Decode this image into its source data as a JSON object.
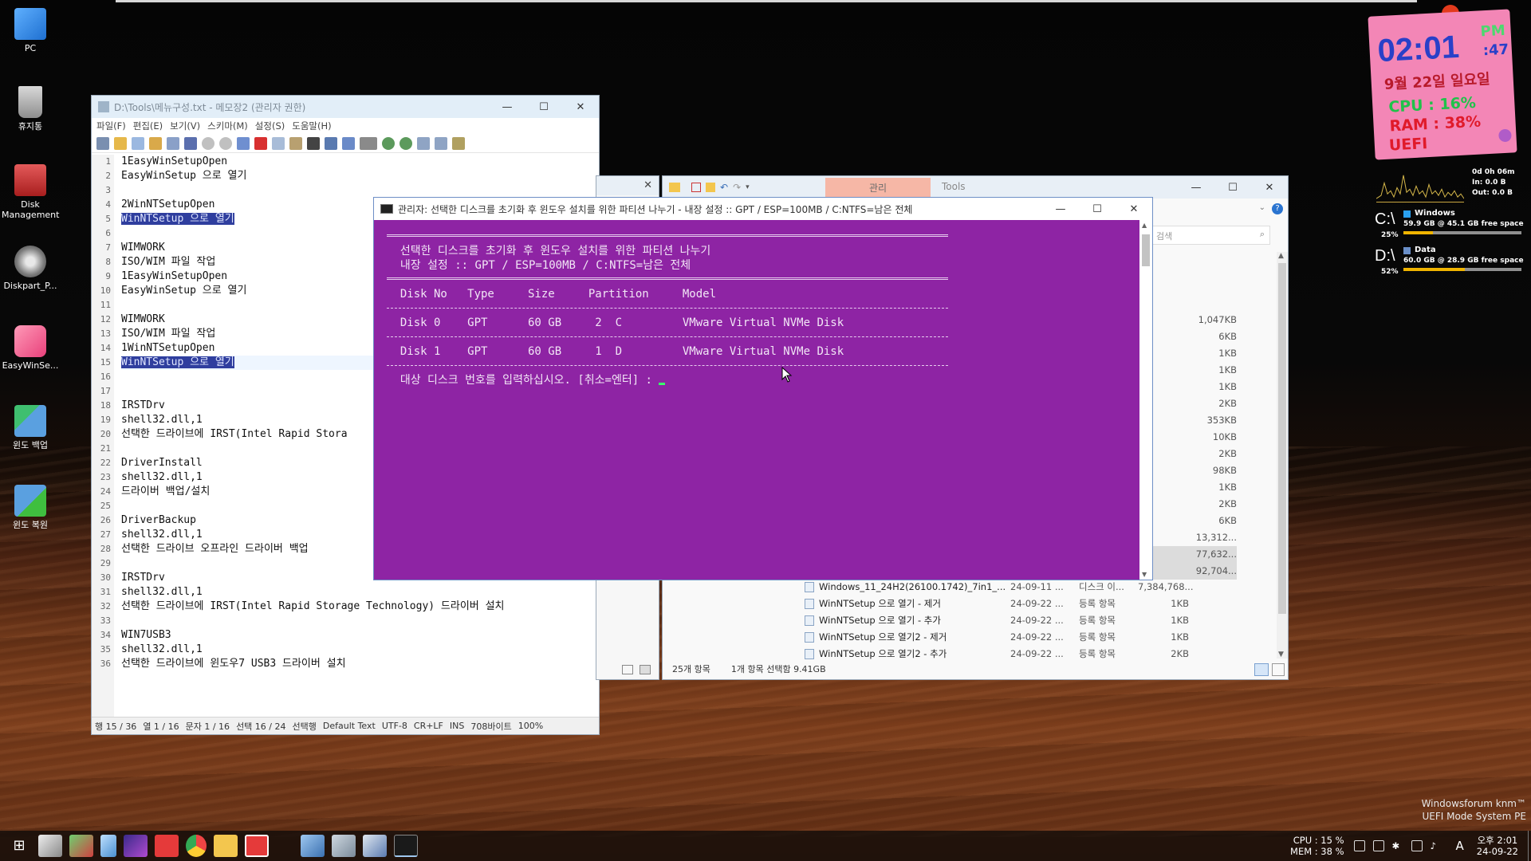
{
  "desktop": {
    "icons": [
      {
        "label": "PC"
      },
      {
        "label": "휴지통"
      },
      {
        "label": "Disk Management"
      },
      {
        "label": "Diskpart_P..."
      },
      {
        "label": "EasyWinSe..."
      },
      {
        "label": "윈도 백업"
      },
      {
        "label": "윈도 복원"
      }
    ]
  },
  "notepad": {
    "title": "D:\\Tools\\메뉴구성.txt - 메모장2 (관리자 권한)",
    "menu": [
      "파일(F)",
      "편집(E)",
      "보기(V)",
      "스키마(M)",
      "설정(S)",
      "도움말(H)"
    ],
    "lines": [
      {
        "n": "1",
        "t": "1EasyWinSetupOpen",
        "hl": false
      },
      {
        "n": "2",
        "t": "EasyWinSetup 으로 열기",
        "hl": false
      },
      {
        "n": "3",
        "t": "",
        "hl": false
      },
      {
        "n": "4",
        "t": "2WinNTSetupOpen",
        "hl": false
      },
      {
        "n": "5",
        "t": "WinNTSetup 으로 열기",
        "hl": true
      },
      {
        "n": "6",
        "t": "",
        "hl": false
      },
      {
        "n": "7",
        "t": "WIMWORK",
        "hl": false
      },
      {
        "n": "8",
        "t": "ISO/WIM 파일 작업",
        "hl": false
      },
      {
        "n": "9",
        "t": "1EasyWinSetupOpen",
        "hl": false
      },
      {
        "n": "10",
        "t": "EasyWinSetup 으로 열기",
        "hl": false
      },
      {
        "n": "11",
        "t": "",
        "hl": false
      },
      {
        "n": "12",
        "t": "WIMWORK",
        "hl": false
      },
      {
        "n": "13",
        "t": "ISO/WIM 파일 작업",
        "hl": false
      },
      {
        "n": "14",
        "t": "1WinNTSetupOpen",
        "hl": false
      },
      {
        "n": "15",
        "t": "WinNTSetup 으로 열기",
        "hl": true
      },
      {
        "n": "16",
        "t": "",
        "hl": false
      },
      {
        "n": "17",
        "t": "",
        "hl": false
      },
      {
        "n": "18",
        "t": "IRSTDrv",
        "hl": false
      },
      {
        "n": "19",
        "t": "shell32.dll,1",
        "hl": false
      },
      {
        "n": "20",
        "t": "선택한 드라이브에 IRST(Intel Rapid Stora",
        "hl": false
      },
      {
        "n": "21",
        "t": "",
        "hl": false
      },
      {
        "n": "22",
        "t": "DriverInstall",
        "hl": false
      },
      {
        "n": "23",
        "t": "shell32.dll,1",
        "hl": false
      },
      {
        "n": "24",
        "t": "드라이버 백업/설치",
        "hl": false
      },
      {
        "n": "25",
        "t": "",
        "hl": false
      },
      {
        "n": "26",
        "t": "DriverBackup",
        "hl": false
      },
      {
        "n": "27",
        "t": "shell32.dll,1",
        "hl": false
      },
      {
        "n": "28",
        "t": "선택한 드라이브 오프라인 드라이버 백업",
        "hl": false
      },
      {
        "n": "29",
        "t": "",
        "hl": false
      },
      {
        "n": "30",
        "t": "IRSTDrv",
        "hl": false
      },
      {
        "n": "31",
        "t": "shell32.dll,1",
        "hl": false
      },
      {
        "n": "32",
        "t": "선택한 드라이브에 IRST(Intel Rapid Storage Technology) 드라이버 설치",
        "hl": false
      },
      {
        "n": "33",
        "t": "",
        "hl": false
      },
      {
        "n": "34",
        "t": "WIN7USB3",
        "hl": false
      },
      {
        "n": "35",
        "t": "shell32.dll,1",
        "hl": false
      },
      {
        "n": "36",
        "t": "선택한 드라이브에 윈도우7 USB3 드라이버 설치",
        "hl": false
      }
    ],
    "status": [
      "행 15 / 36",
      "열 1 / 16",
      "문자 1 / 16",
      "선택 16 / 24",
      "선택행",
      "Default Text",
      "UTF-8",
      "CR+LF",
      "INS",
      "708바이트",
      "100%"
    ]
  },
  "explorer": {
    "tab_manage": "관리",
    "tab_tools": "Tools",
    "search_placeholder": "검색",
    "sizes": [
      "1,047KB",
      "6KB",
      "1KB",
      "1KB",
      "1KB",
      "2KB",
      "353KB",
      "10KB",
      "2KB",
      "98KB",
      "1KB",
      "2KB",
      "6KB",
      "13,312...",
      "77,632...",
      "92,704..."
    ],
    "files": [
      {
        "name": "Windows_11_24H2(26100.1742)_7in1_...",
        "date": "24-09-11 ...",
        "type": "디스크 이...",
        "size": "7,384,768..."
      },
      {
        "name": "WinNTSetup 으로 열기 - 제거",
        "date": "24-09-22 ...",
        "type": "등록 항목",
        "size": "1KB"
      },
      {
        "name": "WinNTSetup 으로 열기 - 추가",
        "date": "24-09-22 ...",
        "type": "등록 항목",
        "size": "1KB"
      },
      {
        "name": "WinNTSetup 으로 열기2 - 제거",
        "date": "24-09-22 ...",
        "type": "등록 항목",
        "size": "1KB"
      },
      {
        "name": "WinNTSetup 으로 열기2 - 추가",
        "date": "24-09-22 ...",
        "type": "등록 항목",
        "size": "2KB"
      }
    ],
    "status_count": "25개 항목",
    "status_selected": "1개 항목 선택함 9.41GB"
  },
  "console": {
    "title": "관리자:  선택한 디스크를 초기화 후 윈도우 설치를 위한 파티션 나누기 - 내장 설정 :: GPT / ESP=100MB / C:NTFS=남은 전체",
    "heading1": "선택한 디스크를 초기화 후 윈도우 설치를 위한 파티션 나누기",
    "heading2": "내장 설정 :: GPT / ESP=100MB / C:NTFS=남은 전체",
    "columns": "Disk No   Type     Size     Partition     Model",
    "disk0": "Disk 0    GPT      60 GB     2  C         VMware Virtual NVMe Disk",
    "disk1": "Disk 1    GPT      60 GB     1  D         VMware Virtual NVMe Disk",
    "prompt": "대상 디스크 번호를 입력하십시오. [취소=엔터] : "
  },
  "clock_widget": {
    "ampm": "PM",
    "time": "02:01",
    "seconds": ":47",
    "date": "9월 22일 일요일",
    "cpu": "CPU :  16%",
    "ram": "RAM :  38%",
    "boot": "UEFI"
  },
  "sys_widget": {
    "uptime": "0d 0h 06m",
    "net_in": "In: 0.0 B",
    "net_out": "Out: 0.0 B",
    "drives": [
      {
        "letter": "C:\\",
        "name": "Windows",
        "info": "59.9 GB @    45.1 GB free space",
        "pct": "25%",
        "used": 0.25
      },
      {
        "letter": "D:\\",
        "name": "Data",
        "info": "60.0 GB @    28.9 GB free space",
        "pct": "52%",
        "used": 0.52
      }
    ]
  },
  "watermark": {
    "line1": "Windowsforum knm™",
    "line2": "UEFI Mode System PE"
  },
  "taskbar": {
    "cpu": "CPU : 15 %",
    "mem": "MEM : 38 %",
    "ime": "A",
    "clock_time": "오후 2:01",
    "clock_date": "24-09-22"
  },
  "colors": {
    "console_bg": "#8e24a4",
    "clock_widget_bg": "#f386b6",
    "selection_highlight": "#2f3e9e"
  }
}
